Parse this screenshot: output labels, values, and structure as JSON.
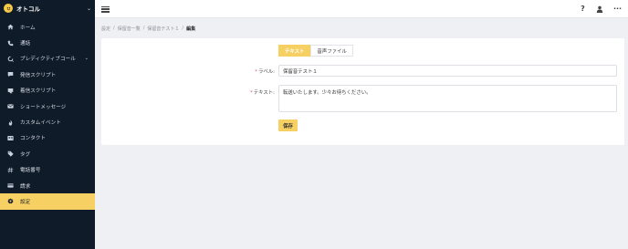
{
  "brand": {
    "name": "オトコル"
  },
  "sidebar": {
    "items": [
      {
        "label": "ホーム",
        "icon": "home-icon"
      },
      {
        "label": "通話",
        "icon": "phone-icon"
      },
      {
        "label": "プレディクティブコール",
        "icon": "predictive-call-icon"
      },
      {
        "label": "発信スクリプト",
        "icon": "outgoing-script-icon"
      },
      {
        "label": "着信スクリプト",
        "icon": "incoming-script-icon"
      },
      {
        "label": "ショートメッセージ",
        "icon": "sms-icon"
      },
      {
        "label": "カスタムイベント",
        "icon": "flame-icon"
      },
      {
        "label": "コンタクト",
        "icon": "contact-card-icon"
      },
      {
        "label": "タグ",
        "icon": "tag-icon"
      },
      {
        "label": "電話番号",
        "icon": "hash-icon"
      },
      {
        "label": "請求",
        "icon": "credit-card-icon"
      },
      {
        "label": "設定",
        "icon": "gear-icon"
      }
    ]
  },
  "breadcrumb": {
    "items": [
      "設定",
      "保留音一覧",
      "保留音テスト１",
      "編集"
    ]
  },
  "form": {
    "tabs": [
      "テキスト",
      "音声ファイル"
    ],
    "label_field": {
      "label": "ラベル:",
      "value": "保留音テスト１"
    },
    "text_field": {
      "label": "テキスト:",
      "value": "転送いたします。少々お待ちください。"
    },
    "save_label": "保存"
  },
  "colors": {
    "sidebar_bg": "#101b29",
    "accent": "#f7d063",
    "page_bg": "#eef0f3"
  }
}
